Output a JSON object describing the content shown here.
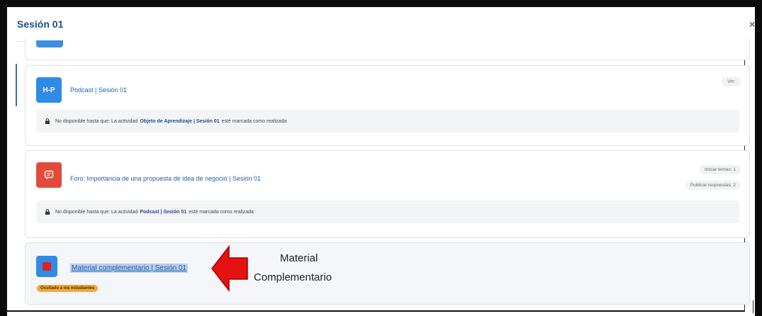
{
  "modal": {
    "title": "Sesión 01",
    "close_symbol": "×"
  },
  "activities": [
    {
      "icon_text": "H-P",
      "title": "Podcast | Sesión 01",
      "action": "Ver",
      "restriction": {
        "prefix": "No disponible hasta que: La actividad",
        "activity": "Objeto de Aprendizaje | Sesión 01",
        "suffix": "esté marcada como realizada"
      }
    },
    {
      "icon": "forum-icon",
      "title": "Foro: Importancia de una propuesta de idea de negocio | Sesión 01",
      "stats": [
        "Iniciar temas: 1",
        "Publicar respuestas: 2"
      ],
      "restriction": {
        "prefix": "No disponible hasta que: La actividad",
        "activity": "Podcast | Sesión 01",
        "suffix": "esté marcada como realizada"
      }
    },
    {
      "icon": "file-icon",
      "title": "Material complementario | Sesión 01",
      "badge": "Ocultado a los estudiantes"
    }
  ],
  "annotation": {
    "line1": "Material",
    "line2": "Complementario",
    "arrow_color": "#e51212"
  }
}
